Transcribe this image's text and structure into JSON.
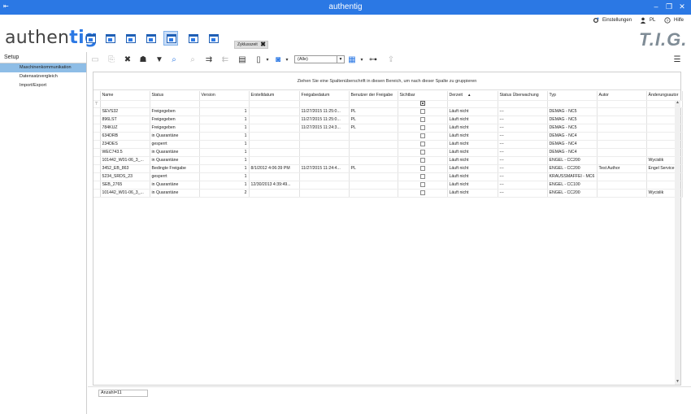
{
  "window": {
    "title": "authentig",
    "app_icon": "app-window-icon"
  },
  "topmenu": {
    "settings": "Einstellungen",
    "user": "PL",
    "help": "Hilfe"
  },
  "logo": {
    "text_a": "authen",
    "text_b": "tig"
  },
  "brand": "T.I.G.",
  "tab_chip": {
    "label": "Zyklusszeit"
  },
  "sidebar": {
    "section": "Setup",
    "items": [
      {
        "label": "Maschinenkommunikation",
        "selected": true
      },
      {
        "label": "Datensatzvergleich",
        "selected": false
      },
      {
        "label": "Import/Export",
        "selected": false
      }
    ]
  },
  "toolbar": {
    "filter_value": "(Alle)"
  },
  "grid": {
    "group_hint": "Ziehen Sie eine Spaltenüberschrift in diesen Bereich, um nach dieser Spalte zu gruppieren",
    "columns": [
      "Name",
      "Status",
      "Version",
      "Erstelldatum",
      "Freigabedatum",
      "Benutzer der Freigabe",
      "Sichtbar",
      "Derzeit",
      "Status Überwachung",
      "Typ",
      "Autor",
      "Änderungsautor"
    ],
    "rows": [
      [
        "SEVS32",
        "Freigegeben",
        "1",
        "",
        "11/27/2015 11:25:0...",
        "PL",
        "",
        "Läuft nicht",
        "---",
        "DEMAG - NC5",
        "",
        ""
      ],
      [
        "896LST",
        "Freigegeben",
        "1",
        "",
        "11/27/2015 11:25:0...",
        "PL",
        "",
        "Läuft nicht",
        "---",
        "DEMAG - NC5",
        "",
        ""
      ],
      [
        "784KUZ",
        "Freigegeben",
        "1",
        "",
        "11/27/2015 11:24:3...",
        "PL",
        "",
        "Läuft nicht",
        "---",
        "DEMAG - NC5",
        "",
        ""
      ],
      [
        "634DRB",
        "in Quarantäne",
        "1",
        "",
        "",
        "",
        "",
        "Läuft nicht",
        "---",
        "DEMAG - NC4",
        "",
        ""
      ],
      [
        "234DES",
        "gesperrt",
        "1",
        "",
        "",
        "",
        "",
        "Läuft nicht",
        "---",
        "DEMAG - NC4",
        "",
        ""
      ],
      [
        "WEC743.5",
        "in Quarantäne",
        "1",
        "",
        "",
        "",
        "",
        "Läuft nicht",
        "---",
        "DEMAG - NC4",
        "",
        ""
      ],
      [
        "101442_W01-06_3_...",
        "in Quarantäne",
        "1",
        "",
        "",
        "",
        "",
        "Läuft nicht",
        "---",
        "ENGEL - CC200",
        "",
        "Wycislik"
      ],
      [
        "3452_EB_863",
        "Bedingte Freigabe",
        "1",
        "8/1/2012 4:06:39 PM",
        "11/27/2015 11:24:4...",
        "PL",
        "",
        "Läuft nicht",
        "---",
        "ENGEL - CC200",
        "Test Author",
        "Engel Service"
      ],
      [
        "5234_SRDS_23",
        "gesperrt",
        "1",
        "",
        "",
        "",
        "",
        "Läuft nicht",
        "---",
        "KRAUSSMAFFEI - MC6",
        "",
        ""
      ],
      [
        "SEB_2765",
        "in Quarantäne",
        "1",
        "12/30/2013 4:39:49...",
        "",
        "",
        "",
        "Läuft nicht",
        "---",
        "ENGEL - CC100",
        "",
        ""
      ],
      [
        "101442_W01-06_3_...",
        "in Quarantäne",
        "2",
        "",
        "",
        "",
        "",
        "Läuft nicht",
        "---",
        "ENGEL - CC200",
        "",
        "Wycislik"
      ]
    ]
  },
  "footer": {
    "count": "Anzahl=11"
  },
  "colors": {
    "titlebar": "#2b78e4",
    "selection": "#8ebde6",
    "accent": "#1f5fb5"
  }
}
